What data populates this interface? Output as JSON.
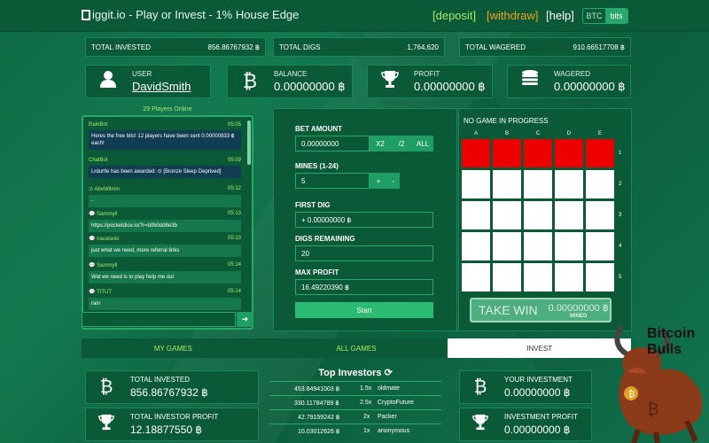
{
  "header": {
    "title": "iggit.io - Play or Invest - 1% House Edge",
    "nav": {
      "deposit": "[deposit]",
      "withdraw": "[withdraw]",
      "help": "[help]"
    },
    "unit_toggle": {
      "btc": "BTC",
      "bits": "bits"
    }
  },
  "stats": {
    "total_invested": {
      "label": "TOTAL INVESTED",
      "value": "856.86767932 ฿"
    },
    "total_digs": {
      "label": "TOTAL DIGS",
      "value": "1,764,620"
    },
    "total_wagered": {
      "label": "TOTAL WAGERED",
      "value": "910.66517708 ฿"
    }
  },
  "cards": {
    "user": {
      "label": "USER",
      "value": "DavidSmith"
    },
    "balance": {
      "label": "BALANCE",
      "value": "0.00000000 ฿"
    },
    "profit": {
      "label": "PROFIT",
      "value": "0.00000000 ฿"
    },
    "wagered": {
      "label": "WAGERED",
      "value": "0.00000000 ฿"
    }
  },
  "chat": {
    "online": "29 Players Online",
    "messages": [
      {
        "user": "RainBot",
        "time": "05:05",
        "text": "Heres the free bits! 12 players have been sent 0.00000833 ฿ each!"
      },
      {
        "user": "ChatBot",
        "time": "05:09",
        "text": "Lrdurtle has been awarded: ⊙ [Bronze Sleep Deprived]"
      },
      {
        "user": "⊙ AbeWilmin",
        "time": "05:12",
        "text": "-"
      },
      {
        "user": "💬 Sammyll",
        "time": "05:13",
        "text": "https://pocketdice.io/?r=b0b0dd8e3b"
      },
      {
        "user": "💬 navataski",
        "time": "05:13",
        "text": "just what we need, more referral links"
      },
      {
        "user": "💬 Sammyll",
        "time": "05:14",
        "text": "Wat we need is to play help me out"
      },
      {
        "user": "💬 TITUT",
        "time": "05:14",
        "text": "rain"
      }
    ],
    "send": "➔"
  },
  "game": {
    "bet_amount_label": "BET AMOUNT",
    "bet_amount": "0.00000000",
    "x2": "X2",
    "half": "/2",
    "all": "ALL",
    "mines_label": "MINES (1-24)",
    "mines": "5",
    "plus": "+",
    "minus": "-",
    "first_dig_label": "FIRST DIG",
    "first_dig": "+ 0.00000000 ฿",
    "digs_remaining_label": "DIGS REMAINING",
    "digs_remaining": "20",
    "max_profit_label": "MAX PROFIT",
    "max_profit": "16.49220390 ฿",
    "start": "Start"
  },
  "grid": {
    "title": "NO GAME IN PROGRESS",
    "columns": [
      "A",
      "B",
      "C",
      "D",
      "E"
    ],
    "rows": [
      "1",
      "2",
      "3",
      "4",
      "5"
    ],
    "take_win": "TAKE WIN",
    "mined_value": "0.00000000 ฿",
    "mined_label": "MINED"
  },
  "tabs": {
    "my_games": "MY GAMES",
    "all_games": "ALL GAMES",
    "invest": "INVEST"
  },
  "invest": {
    "total_invested": {
      "label": "TOTAL INVESTED",
      "value": "856.86767932 ฿"
    },
    "total_investor_profit": {
      "label": "TOTAL INVESTOR PROFIT",
      "value": "12.18877550 ฿"
    },
    "your_investment": {
      "label": "YOUR INVESTMENT",
      "value": "0.00000000 ฿"
    },
    "investment_profit": {
      "label": "INVESTMENT PROFIT",
      "value": "0.00000000 ฿"
    },
    "top_title": "Top Investors ⟳",
    "top": [
      {
        "amount": "453.84941003 ฿",
        "mult": "1.5x",
        "name": "oldmate"
      },
      {
        "amount": "330.11784789 ฿",
        "mult": "2.5x",
        "name": "CryptoFuture"
      },
      {
        "amount": "42.79159242 ฿",
        "mult": "2x",
        "name": "Packer"
      },
      {
        "amount": "10.03012626 ฿",
        "mult": "1x",
        "name": "anonymous"
      }
    ]
  },
  "watermark": {
    "line1": "Bitcoin",
    "line2": "Bulls"
  },
  "colors": {
    "accent": "#2aa86b",
    "mine": "#ee0000",
    "deposit": "#a8e66b",
    "withdraw": "#f0a020"
  }
}
